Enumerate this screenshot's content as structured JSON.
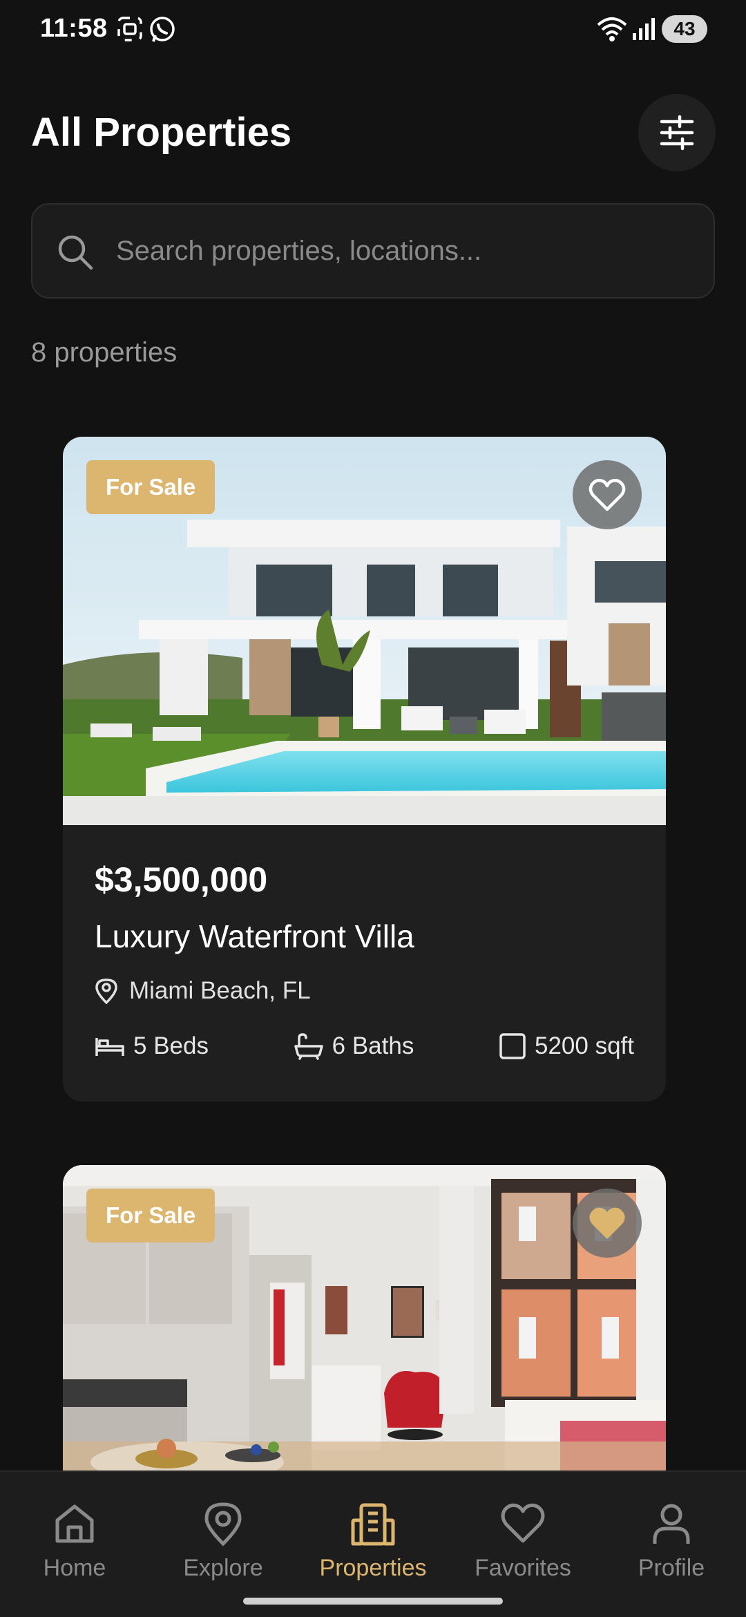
{
  "status_bar": {
    "time": "11:58",
    "battery": "43"
  },
  "header": {
    "title": "All Properties"
  },
  "search": {
    "placeholder": "Search properties, locations..."
  },
  "results": {
    "count_text": "8 properties"
  },
  "properties": [
    {
      "badge": "For Sale",
      "price": "$3,500,000",
      "title": "Luxury Waterfront Villa",
      "location": "Miami Beach, FL",
      "beds": "5 Beds",
      "baths": "6 Baths",
      "area": "5200 sqft",
      "favorited": false
    },
    {
      "badge": "For Sale",
      "favorited": true
    }
  ],
  "nav": {
    "items": [
      {
        "label": "Home",
        "icon": "home-icon"
      },
      {
        "label": "Explore",
        "icon": "map-pin-icon"
      },
      {
        "label": "Properties",
        "icon": "building-icon"
      },
      {
        "label": "Favorites",
        "icon": "heart-icon"
      },
      {
        "label": "Profile",
        "icon": "user-icon"
      }
    ],
    "active": "Properties"
  },
  "colors": {
    "accent": "#dcb56e",
    "background": "#121212",
    "card": "#1f1f1f"
  }
}
